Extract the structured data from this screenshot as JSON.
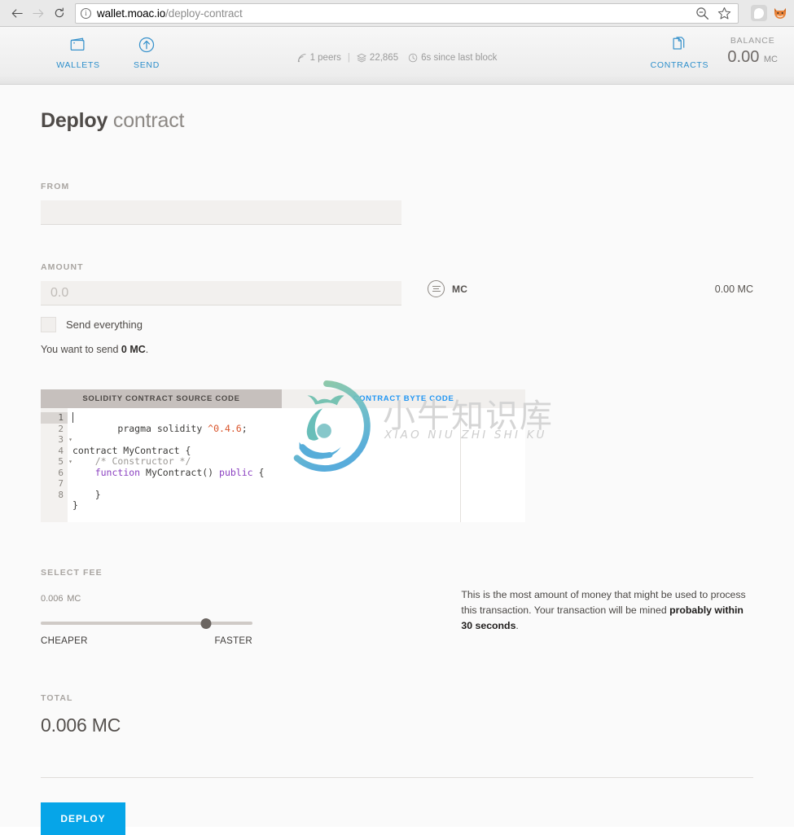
{
  "browser": {
    "back_icon": "arrow-left-icon",
    "forward_icon": "arrow-right-icon",
    "reload_icon": "reload-icon",
    "url_domain": "wallet.moac.io",
    "url_path": "/deploy-contract",
    "info_glyph": "i",
    "zoom_icon": "search-minus-icon",
    "bookmark_icon": "star-icon",
    "extension_icon": "extension-icon",
    "profile_icon": "fox-icon"
  },
  "header": {
    "nav": [
      {
        "label": "WALLETS",
        "icon": "wallet-icon"
      },
      {
        "label": "SEND",
        "icon": "send-arrow-up-icon"
      },
      {
        "label": "CONTRACTS",
        "icon": "contracts-documents-icon"
      }
    ],
    "status": {
      "peers": "1 peers",
      "separator": "|",
      "blocks": "22,865",
      "last_block": "6s since last block",
      "peers_icon": "signal-icon",
      "blocks_icon": "blocks-stack-icon",
      "clock_icon": "clock-icon"
    },
    "balance": {
      "label": "BALANCE",
      "value": "0.00",
      "unit": "MC"
    }
  },
  "page": {
    "title_bold": "Deploy",
    "title_light": "contract",
    "from": {
      "label": "FROM",
      "value": ""
    },
    "amount": {
      "label": "AMOUNT",
      "placeholder": "0.0",
      "value": "",
      "unit_selected": "MC",
      "unit_icon": "unit-menu-icon",
      "available_balance": "0.00 MC",
      "checkbox_label": "Send everything",
      "checkbox_checked": false,
      "note_prefix": "You want to send ",
      "note_amount": "0 MC",
      "note_suffix": "."
    },
    "editor": {
      "tabs": [
        {
          "label": "SOLIDITY CONTRACT SOURCE CODE",
          "active": true
        },
        {
          "label": "CONTRACT BYTE CODE",
          "active": false
        }
      ],
      "line_numbers": [
        "1",
        "2",
        "3",
        "4",
        "5",
        "6",
        "7",
        "8"
      ],
      "active_line": 1,
      "fold_lines": [
        3,
        5
      ],
      "code_lines": [
        "pragma solidity ^0.4.6;",
        "",
        "contract MyContract {",
        "    /* Constructor */",
        "    function MyContract() public {",
        "",
        "    }",
        "}"
      ],
      "byte_code": ""
    },
    "fee": {
      "label": "SELECT FEE",
      "value": "0.006",
      "unit": "MC",
      "slider_position_pct": 78,
      "min_label": "CHEAPER",
      "max_label": "FASTER",
      "description_1": "This is the most amount of money that might be used to process this",
      "description_2_prefix": "transaction. Your transaction will be mined ",
      "description_2_bold": "probably within 30 seconds",
      "description_2_suffix": "."
    },
    "total": {
      "label": "TOTAL",
      "value": "0.006 MC"
    },
    "deploy_button": "DEPLOY"
  },
  "watermark": {
    "cn": "小牛知识库",
    "pinyin": "XIAO NIU ZHI SHI KU"
  },
  "colors": {
    "accent_blue": "#2d8fcb",
    "deploy_blue": "#06a5e8",
    "tab_link_blue": "#2196f3",
    "page_bg": "#fafafa"
  }
}
